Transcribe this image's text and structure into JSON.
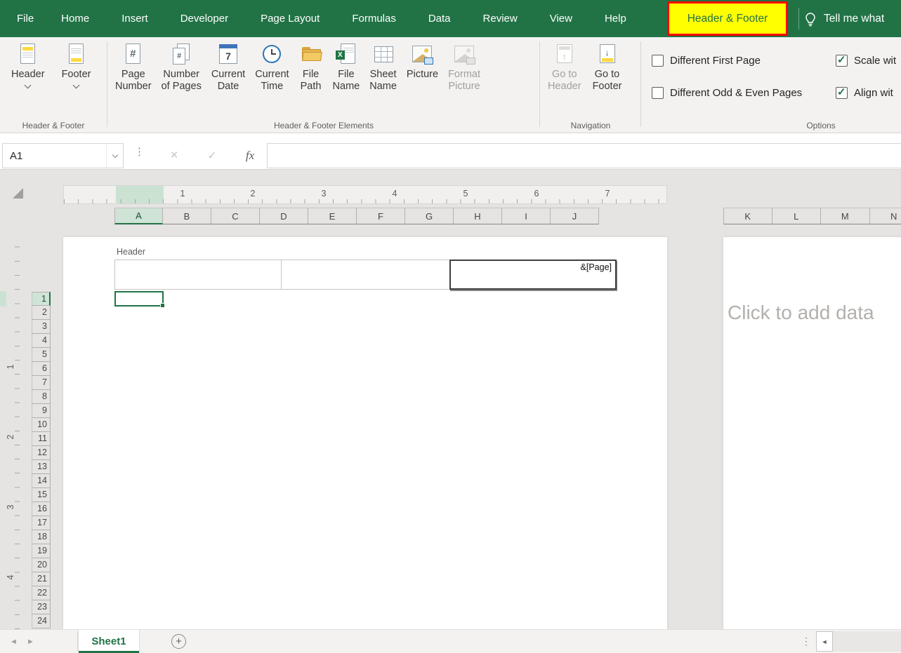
{
  "colors": {
    "excel_green": "#217346",
    "contextual_tab_bg": "#ffff00",
    "contextual_tab_border": "#ff0000"
  },
  "icons": {
    "cancel": "×",
    "enter": "✓",
    "function": "fx",
    "dots_splitter": "⋮",
    "prev_sheet": "◄",
    "next_sheet": "►",
    "scroll_left": "◄",
    "add_sheet": "+",
    "hash": "#",
    "calendar_day": "7",
    "excel_x": "X",
    "arrow_up": "↑",
    "arrow_down": "↓"
  },
  "ribbon_tabs": {
    "items": [
      "File",
      "Home",
      "Insert",
      "Developer",
      "Page Layout",
      "Formulas",
      "Data",
      "Review",
      "View",
      "Help"
    ],
    "contextual_tab": "Header & Footer",
    "tell_me_label": "Tell me what"
  },
  "ribbon": {
    "header_footer_group": {
      "label": "Header & Footer",
      "buttons": [
        {
          "label": "Header"
        },
        {
          "label": "Footer"
        }
      ]
    },
    "elements_group": {
      "label": "Header & Footer Elements",
      "buttons": [
        {
          "line1": "Page",
          "line2": "Number"
        },
        {
          "line1": "Number",
          "line2": "of Pages"
        },
        {
          "line1": "Current",
          "line2": "Date"
        },
        {
          "line1": "Current",
          "line2": "Time"
        },
        {
          "line1": "File",
          "line2": "Path"
        },
        {
          "line1": "File",
          "line2": "Name"
        },
        {
          "line1": "Sheet",
          "line2": "Name"
        },
        {
          "line1": "Picture",
          "line2": ""
        },
        {
          "line1": "Format",
          "line2": "Picture",
          "disabled": true
        }
      ]
    },
    "navigation_group": {
      "label": "Navigation",
      "buttons": [
        {
          "line1": "Go to",
          "line2": "Header",
          "disabled": true
        },
        {
          "line1": "Go to",
          "line2": "Footer"
        }
      ]
    },
    "options_group": {
      "label": "Options",
      "checkboxes": [
        {
          "label": "Different First Page",
          "checked": false
        },
        {
          "label": "Different Odd & Even Pages",
          "checked": false
        },
        {
          "label": "Scale wit",
          "checked": true
        },
        {
          "label": "Align wit",
          "checked": true
        }
      ]
    }
  },
  "formula_bar": {
    "name_box_value": "A1",
    "formula_value": ""
  },
  "worksheet": {
    "h_ruler_numbers": [
      "1",
      "2",
      "3",
      "4",
      "5",
      "6",
      "7"
    ],
    "v_ruler_numbers": [
      "1",
      "2",
      "3",
      "4"
    ],
    "columns_left": [
      {
        "label": "A",
        "state": "selected"
      },
      {
        "label": "B"
      },
      {
        "label": "C"
      },
      {
        "label": "D"
      },
      {
        "label": "E"
      },
      {
        "label": "F"
      },
      {
        "label": "G"
      },
      {
        "label": "H"
      },
      {
        "label": "I"
      },
      {
        "label": "J"
      }
    ],
    "columns_right": [
      {
        "label": "K"
      },
      {
        "label": "L"
      },
      {
        "label": "M"
      },
      {
        "label": "N"
      }
    ],
    "rows": [
      {
        "label": "1",
        "state": "selected"
      },
      {
        "label": "2"
      },
      {
        "label": "3"
      },
      {
        "label": "4"
      },
      {
        "label": "5"
      },
      {
        "label": "6"
      },
      {
        "label": "7"
      },
      {
        "label": "8"
      },
      {
        "label": "9"
      },
      {
        "label": "10"
      },
      {
        "label": "11"
      },
      {
        "label": "12"
      },
      {
        "label": "13"
      },
      {
        "label": "14"
      },
      {
        "label": "15"
      },
      {
        "label": "16"
      },
      {
        "label": "17"
      },
      {
        "label": "18"
      },
      {
        "label": "19"
      },
      {
        "label": "20"
      },
      {
        "label": "21"
      },
      {
        "label": "22"
      },
      {
        "label": "23"
      },
      {
        "label": "24"
      }
    ],
    "header_area": {
      "label": "Header",
      "left_section": "",
      "center_section": "",
      "right_section": "&[Page]"
    },
    "right_page_placeholder": "Click to add data"
  },
  "sheet_bar": {
    "sheets": [
      {
        "label": "Sheet1",
        "state": "active"
      }
    ]
  }
}
